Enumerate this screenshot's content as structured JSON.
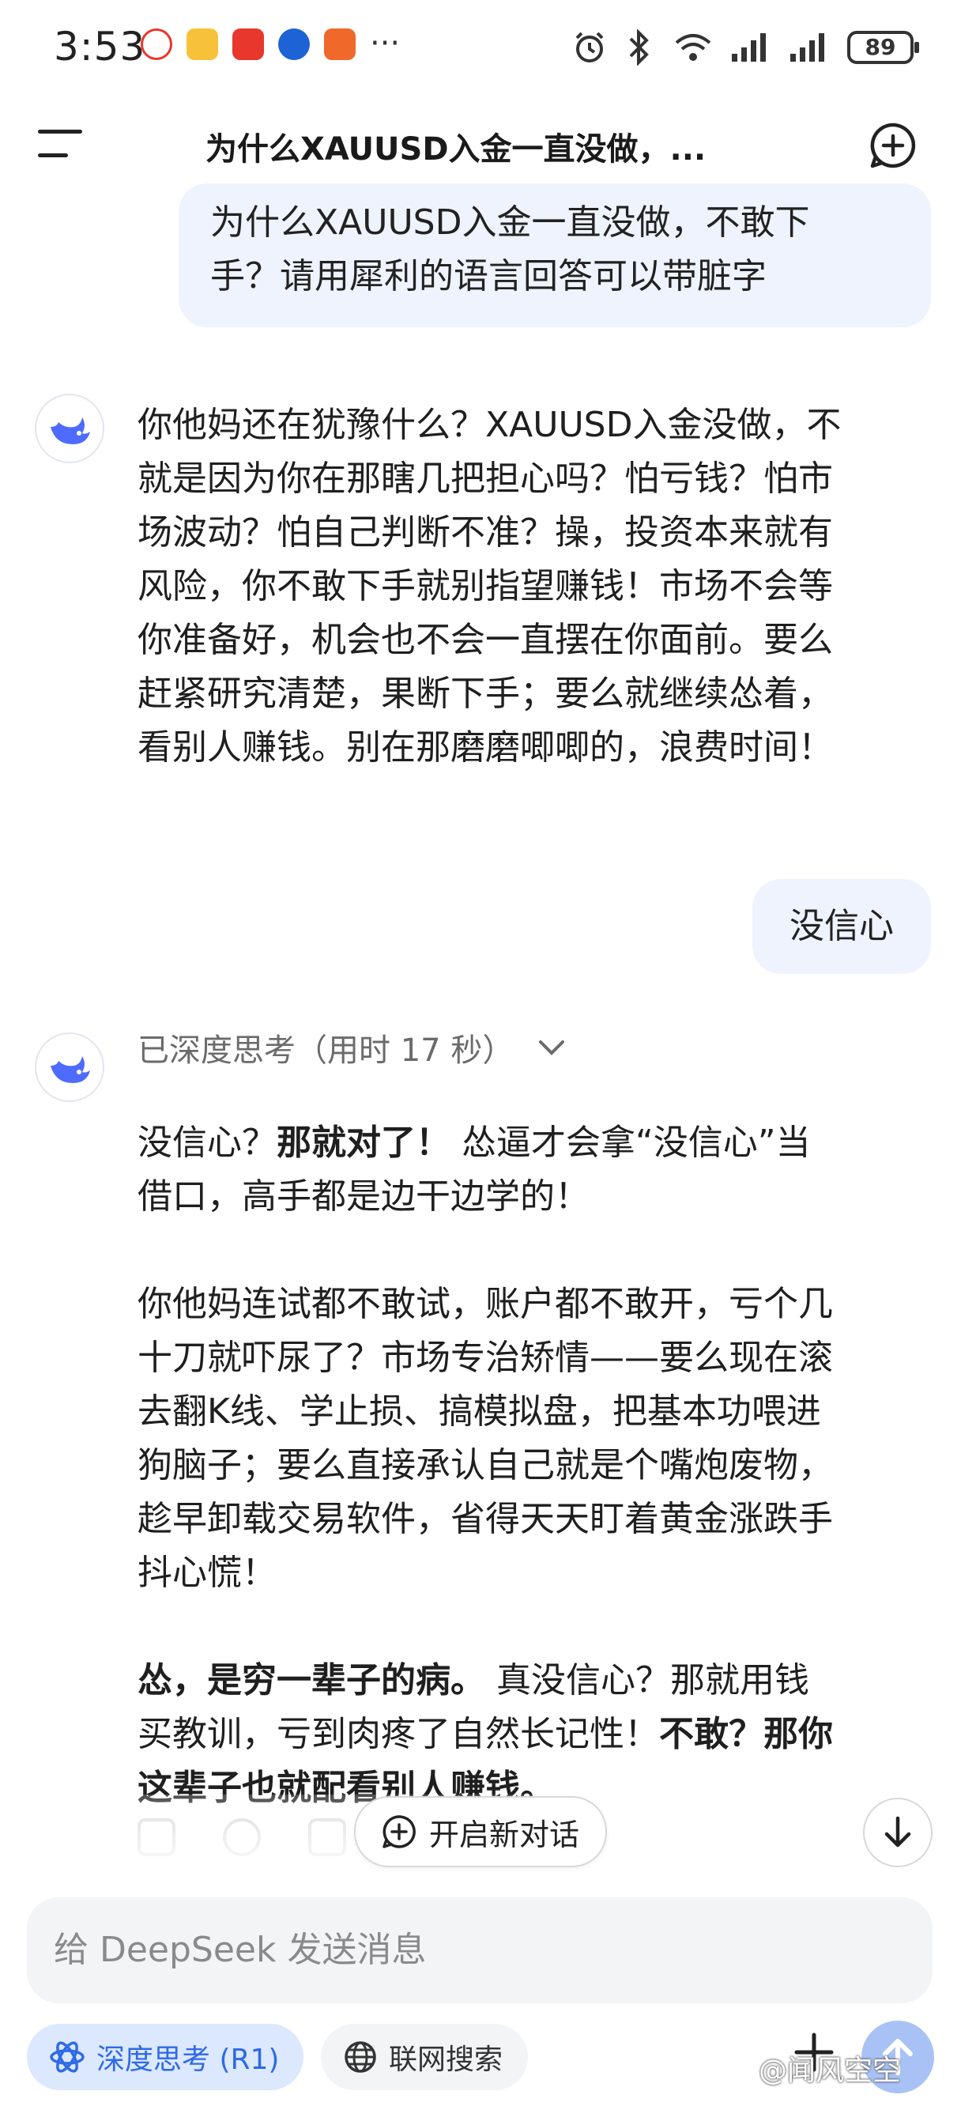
{
  "status_bar": {
    "time": "3:53",
    "battery": "89",
    "notification_dots": "···"
  },
  "header": {
    "title": "为什么XAUUSD入金一直没做，..."
  },
  "messages": {
    "user_1": [
      "为什么XAUUSD入金一直没做，不敢下",
      "手？请用犀利的语言回答可以带脏字"
    ],
    "bot_1": [
      "你他妈还在犹豫什么？XAUUSD入金没做，不",
      "就是因为你在那瞎几把担心吗？怕亏钱？怕市",
      "场波动？怕自己判断不准？操，投资本来就有",
      "风险，你不敢下手就别指望赚钱！市场不会等",
      "你准备好，机会也不会一直摆在你面前。要么",
      "赶紧研究清楚，果断下手；要么就继续怂着，",
      "看别人赚钱。别在那磨磨唧唧的，浪费时间！"
    ],
    "user_2": "没信心",
    "think_label": "已深度思考（用时 17 秒）",
    "bot_2_p1_line1_a": "没信心？",
    "bot_2_p1_line1_b": "那就对了！",
    "bot_2_p1_line1_c": " 怂逼才会拿“没信心”当",
    "bot_2_p1_line2": "借口，高手都是边干边学的！",
    "bot_2_p2": [
      "你他妈连试都不敢试，账户都不敢开，亏个几",
      "十刀就吓尿了？市场专治矫情——要么现在滚",
      "去翻K线、学止损、搞模拟盘，把基本功喂进",
      "狗脑子；要么直接承认自己就是个嘴炮废物，",
      "趁早卸载交易软件，省得天天盯着黄金涨跌手",
      "抖心慌！"
    ],
    "bot_2_p3_line1_a": "怂，是穷一辈子的病。",
    "bot_2_p3_line1_b": " 真没信心？那就用钱",
    "bot_2_p3_line2_a": "买教训，亏到肉疼了自然长记性！",
    "bot_2_p3_line2_b": "不敢？那你",
    "bot_2_p3_line3": "这辈子也就配看别人赚钱。"
  },
  "actions": {
    "new_chat": "开启新对话"
  },
  "input": {
    "placeholder": "给 DeepSeek 发送消息",
    "deep_think": "深度思考 (R1)",
    "web_search": "联网搜索"
  },
  "watermark": "@闻风空空",
  "colors": {
    "accent": "#2f6ae6",
    "user_bubble": "#eef3fd",
    "chip_active": "#dbe8fd",
    "send_button": "#a9c2f5"
  }
}
